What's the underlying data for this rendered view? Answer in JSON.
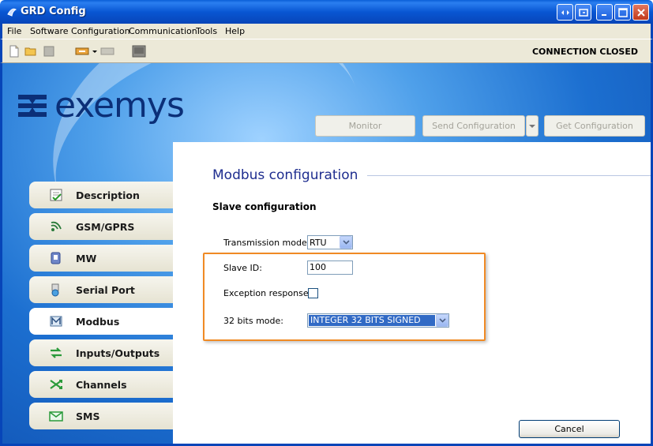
{
  "window": {
    "title": "GRD Config"
  },
  "menu": {
    "items": [
      "File",
      "Software Configuration",
      "Communication",
      "Tools",
      "Help"
    ]
  },
  "toolbar": {
    "status": "CONNECTION CLOSED"
  },
  "brand": {
    "logo_text": "exemys"
  },
  "actions": {
    "monitor": "Monitor",
    "send": "Send Configuration",
    "get": "Get Configuration"
  },
  "nav": {
    "items": [
      {
        "label": "Description",
        "icon": "document-check-icon"
      },
      {
        "label": "GSM/GPRS",
        "icon": "wireless-icon"
      },
      {
        "label": "MW",
        "icon": "device-icon"
      },
      {
        "label": "Serial Port",
        "icon": "serial-port-icon"
      },
      {
        "label": "Modbus",
        "icon": "modbus-icon"
      },
      {
        "label": "Inputs/Outputs",
        "icon": "arrows-io-icon"
      },
      {
        "label": "Channels",
        "icon": "channels-icon"
      },
      {
        "label": "SMS",
        "icon": "envelope-icon"
      }
    ],
    "active": "Modbus"
  },
  "panel": {
    "title": "Modbus configuration",
    "section": "Slave configuration",
    "transmission_mode": {
      "label": "Transmission mode:",
      "value": "RTU"
    },
    "slave_id": {
      "label": "Slave ID:",
      "value": "100"
    },
    "exception_response": {
      "label": "Exception response:",
      "checked": false
    },
    "bits_mode": {
      "label": "32 bits mode:",
      "value": "INTEGER 32 BITS SIGNED"
    },
    "cancel": "Cancel"
  },
  "colors": {
    "accent": "#1e2d8f",
    "highlight": "#f08a24",
    "titlebar": "#0856d3"
  }
}
